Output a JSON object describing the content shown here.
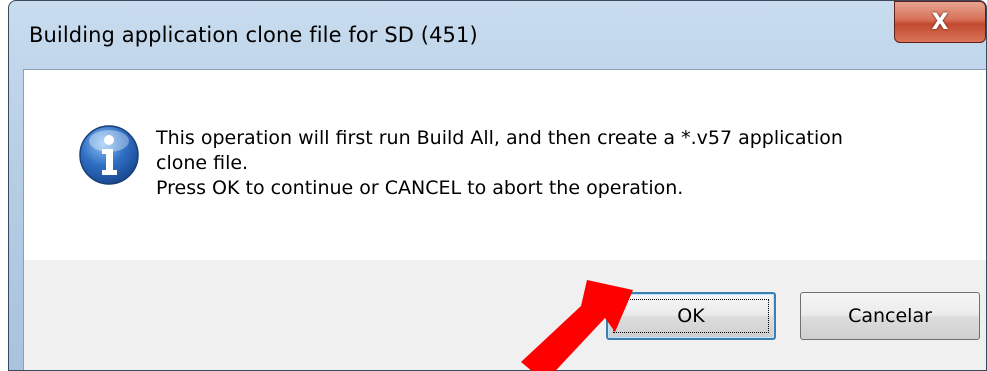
{
  "window": {
    "title": "Building application clone file for SD (451)",
    "close_label": "X"
  },
  "message": {
    "lines": [
      "This operation will first run Build All, and then create a *.v57 application",
      "clone file.",
      "Press OK to continue or CANCEL to abort the operation."
    ]
  },
  "buttons": {
    "ok_label": "OK",
    "cancel_label": "Cancelar"
  },
  "icons": {
    "message_icon": "info-icon",
    "annotation": "red-arrow-icon"
  },
  "colors": {
    "arrow": "#ff0000",
    "info_icon": "#2f6fc4",
    "close_button": "#c24a30",
    "focus_border": "#3c7fb1"
  }
}
